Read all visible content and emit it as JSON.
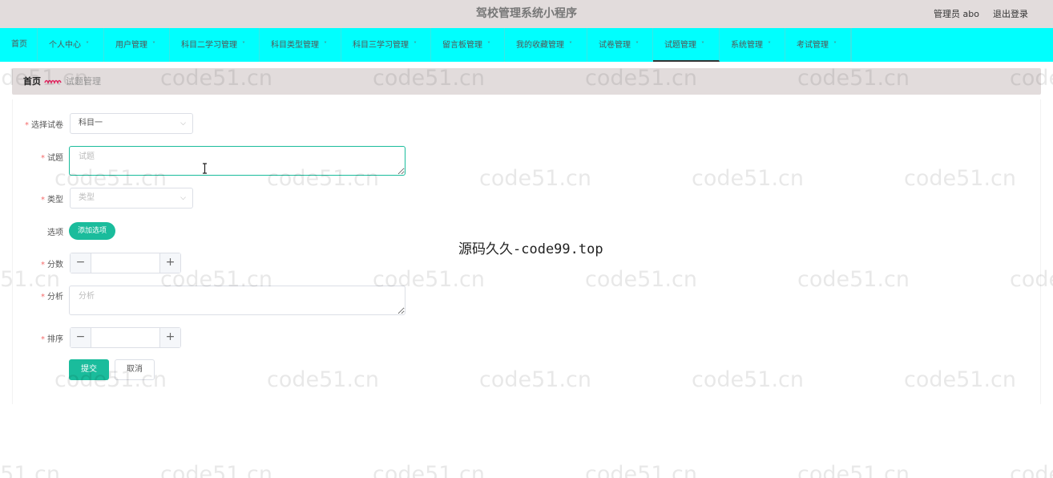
{
  "header": {
    "title": "驾校管理系统小程序",
    "user": "管理员 abo",
    "logout": "退出登录"
  },
  "nav": {
    "items": [
      {
        "label": "首页",
        "has_dropdown": false
      },
      {
        "label": "个人中心",
        "has_dropdown": true
      },
      {
        "label": "用户管理",
        "has_dropdown": true
      },
      {
        "label": "科目二学习管理",
        "has_dropdown": true
      },
      {
        "label": "科目类型管理",
        "has_dropdown": true
      },
      {
        "label": "科目三学习管理",
        "has_dropdown": true
      },
      {
        "label": "留言板管理",
        "has_dropdown": true
      },
      {
        "label": "我的收藏管理",
        "has_dropdown": true
      },
      {
        "label": "试卷管理",
        "has_dropdown": true
      },
      {
        "label": "试题管理",
        "has_dropdown": true,
        "active": true
      },
      {
        "label": "系统管理",
        "has_dropdown": true
      },
      {
        "label": "考试管理",
        "has_dropdown": true
      }
    ],
    "chevron": "˅"
  },
  "breadcrumb": {
    "home": "首页",
    "current": "试题管理"
  },
  "form": {
    "paper": {
      "label": "选择试卷",
      "value": "科目一"
    },
    "question": {
      "label": "试题",
      "placeholder": "试题"
    },
    "type": {
      "label": "类型",
      "placeholder": "类型"
    },
    "options": {
      "label": "选项",
      "add_button": "添加选项"
    },
    "score": {
      "label": "分数",
      "value": ""
    },
    "analysis": {
      "label": "分析",
      "placeholder": "分析"
    },
    "sort": {
      "label": "排序",
      "value": ""
    },
    "submit": "提交",
    "cancel": "取消",
    "required_mark": "*",
    "minus": "−",
    "plus": "+",
    "caret": "⌵"
  },
  "watermark": {
    "text": "code51.cn",
    "center_text": "源码久久-code99.top"
  },
  "colors": {
    "topbar": "#e2dcdc",
    "navbar": "#00fffe",
    "accent": "#1abc9c",
    "required": "#f56c6c"
  }
}
